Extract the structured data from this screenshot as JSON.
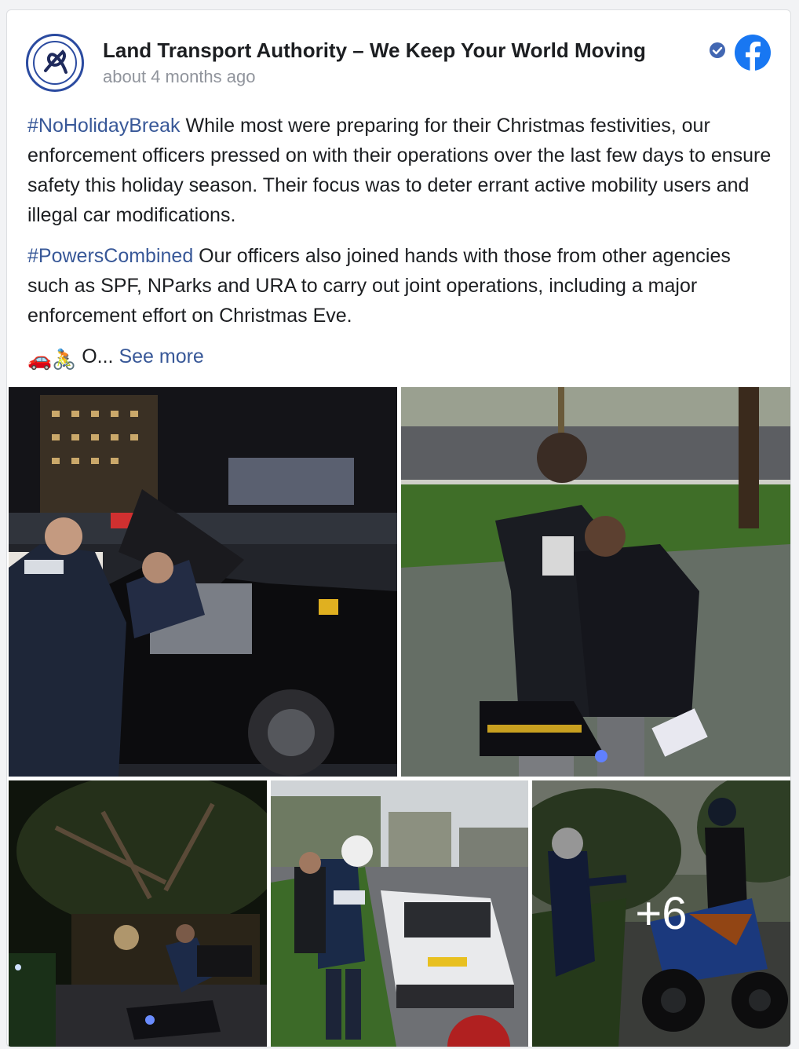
{
  "post": {
    "page_name": "Land Transport Authority – We Keep Your World Moving",
    "timestamp": "about 4 months ago",
    "avatar_icon": "lta-logo-icon",
    "verified_icon": "verified-badge-icon",
    "platform_icon": "facebook-icon",
    "colors": {
      "link": "#385898",
      "facebook_blue": "#1877f2",
      "verified": "#4267b2"
    }
  },
  "text": {
    "p1_hashtag": "#NoHolidayBreak",
    "p1_body": " While most were preparing for their Christmas festivities, our enforcement officers pressed on with their operations over the last few days to ensure safety this holiday season. Their focus was to deter errant active mobility users and illegal car modifications.",
    "p2_hashtag": "#PowersCombined",
    "p2_body": " Our officers also joined hands with those from other agencies such as SPF, NParks and URA to carry out joint operations, including a major enforcement effort on Christmas Eve.",
    "p3_emojis": "🚗🚴",
    "p3_body": " O... ",
    "see_more": "See more"
  },
  "photos": {
    "more_count": "+6"
  }
}
